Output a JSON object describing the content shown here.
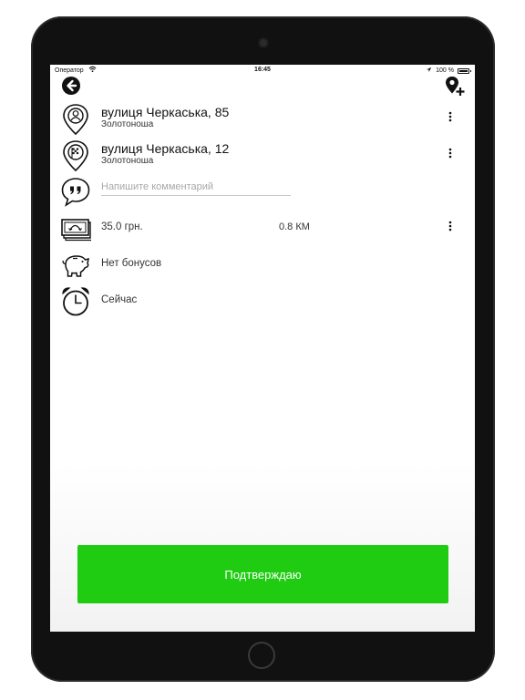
{
  "status_bar": {
    "carrier": "Оператор",
    "time": "16:45",
    "battery": "100 %"
  },
  "icons": {
    "back": "back-arrow-icon",
    "add_location": "add-location-icon",
    "pickup": "pickup-pin-icon",
    "destination": "destination-flag-pin-icon",
    "comment": "comment-quote-icon",
    "price": "money-icon",
    "bonus": "piggy-bank-icon",
    "time": "alarm-clock-icon",
    "more": "more-vertical-icon"
  },
  "route": {
    "from": {
      "street": "вулиця Черкаська, 85",
      "city": "Золотоноша"
    },
    "to": {
      "street": "вулиця Черкаська, 12",
      "city": "Золотоноша"
    }
  },
  "comment": {
    "placeholder": "Напишите комментарий",
    "value": ""
  },
  "price": {
    "amount": "35.0 грн.",
    "distance": "0.8 КМ"
  },
  "bonus": {
    "text": "Нет бонусов"
  },
  "time": {
    "text": "Сейчас"
  },
  "confirm_button": {
    "label": "Подтверждаю"
  },
  "colors": {
    "accent": "#1fcc12",
    "text": "#111111",
    "placeholder": "#a8a8a8"
  }
}
